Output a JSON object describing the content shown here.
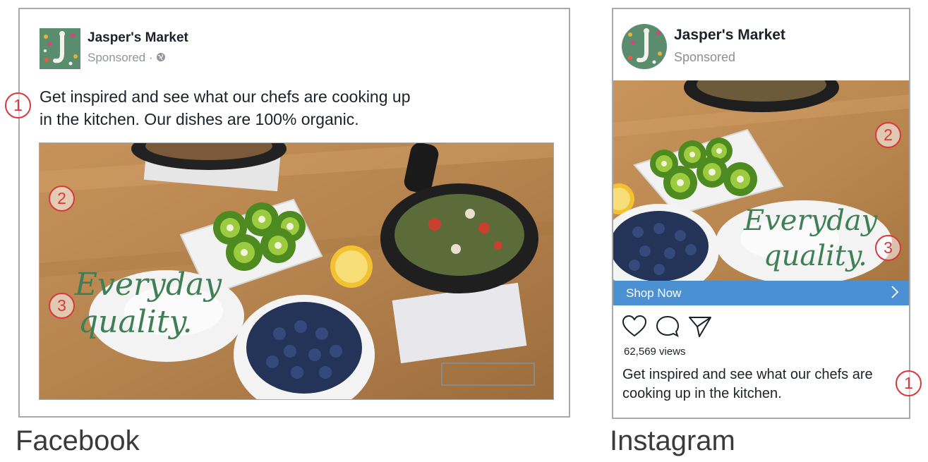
{
  "facebook": {
    "page_name": "Jasper's Market",
    "sponsored_text": "Sponsored · ",
    "body_text_line1": "Get inspired and see what our chefs are cooking up",
    "body_text_line2": "in the kitchen. Our dishes are 100% organic.",
    "overlay_line1": "Everyday",
    "overlay_line2": "quality.",
    "platform_label": "Facebook",
    "markers": {
      "text": "1",
      "image": "2",
      "overlay": "3"
    }
  },
  "instagram": {
    "page_name": "Jasper's Market",
    "sponsored_text": "Sponsored",
    "overlay_line1": "Everyday",
    "overlay_line2": "quality.",
    "shop_button_label": "Shop Now",
    "views_text": "62,569 views",
    "caption_line1": "Get inspired and see what our chefs are",
    "caption_line2": "cooking up in the kitchen.",
    "platform_label": "Instagram",
    "markers": {
      "text": "1",
      "image": "2",
      "overlay": "3"
    },
    "icons": [
      "heart-icon",
      "comment-icon",
      "share-icon",
      "chevron-right-icon"
    ]
  },
  "colors": {
    "marker_red": "#d9373f",
    "cta_blue": "#4a90d2",
    "overlay_green": "#3f7f55",
    "avatar_green": "#5a8c6e"
  }
}
